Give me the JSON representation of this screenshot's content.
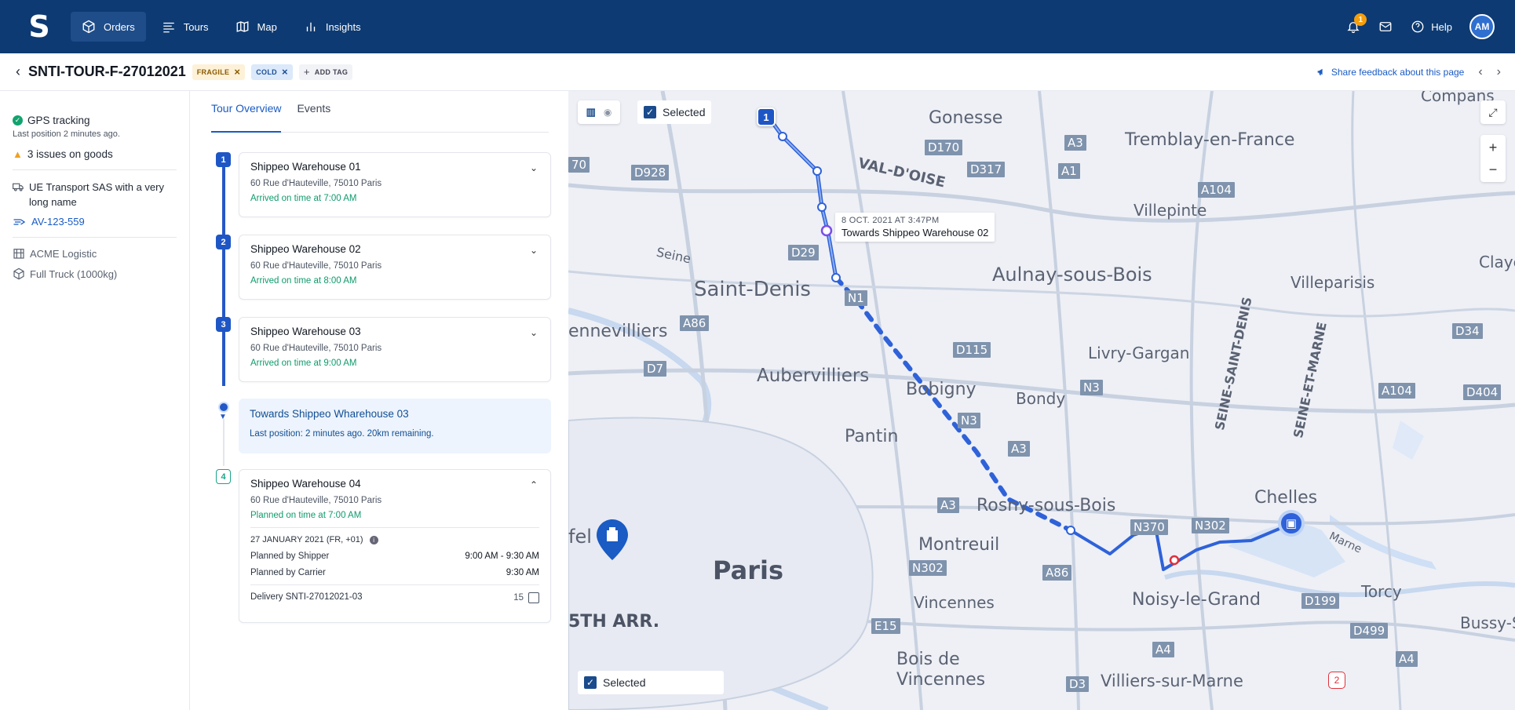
{
  "nav": {
    "logo": "S",
    "items": [
      {
        "label": "Orders",
        "icon": "box-icon",
        "active": true
      },
      {
        "label": "Tours",
        "icon": "list-icon",
        "active": false
      },
      {
        "label": "Map",
        "icon": "map-icon",
        "active": false
      },
      {
        "label": "Insights",
        "icon": "chart-icon",
        "active": false
      }
    ],
    "notifications_count": "1",
    "help_label": "Help",
    "avatar_initials": "AM"
  },
  "header": {
    "title": "SNTI-TOUR-F-27012021",
    "tags": [
      {
        "label": "FRAGILE"
      },
      {
        "label": "COLD"
      }
    ],
    "add_tag_label": "ADD TAG",
    "feedback_label": "Share feedback about this page"
  },
  "left": {
    "gps_label": "GPS tracking",
    "gps_sub": "Last position 2 minutes ago.",
    "issues_label": "3 issues on goods",
    "carrier": "UE Transport SAS with a very long name",
    "vehicle": "AV-123-559",
    "shipper": "ACME Logistic",
    "capacity": "Full Truck (1000kg)"
  },
  "tabs": [
    {
      "label": "Tour Overview"
    },
    {
      "label": "Events"
    }
  ],
  "stops": [
    {
      "n": "1",
      "title": "Shippeo Warehouse 01",
      "addr": "60 Rue d'Hauteville, 75010 Paris",
      "status": "Arrived on time at 7:00 AM"
    },
    {
      "n": "2",
      "title": "Shippeo Warehouse 02",
      "addr": "60 Rue d'Hauteville, 75010 Paris",
      "status": "Arrived on time at 8:00 AM"
    },
    {
      "n": "3",
      "title": "Shippeo Warehouse 03",
      "addr": "60 Rue d'Hauteville, 75010 Paris",
      "status": "Arrived on time at 9:00 AM"
    },
    {
      "n": "4",
      "title": "Shippeo Warehouse 04",
      "addr": "60 Rue d'Hauteville, 75010 Paris",
      "status": "Planned on time at 7:00 AM"
    }
  ],
  "transit": {
    "title": "Towards Shippeo Wharehouse 03",
    "sub": "Last position: 2 minutes ago. 20km remaining."
  },
  "stop4_details": {
    "date": "27 JANUARY 2021 (FR, +01)",
    "shipper_label": "Planned by Shipper",
    "shipper_value": "9:00 AM - 9:30 AM",
    "carrier_label": "Planned by Carrier",
    "carrier_value": "9:30 AM",
    "delivery_label": "Delivery SNTI-27012021-03",
    "delivery_count": "15"
  },
  "map": {
    "selected_label": "Selected",
    "tooltip_time": "8 OCT. 2021 AT 3:47PM",
    "tooltip_text": "Towards Shippeo Warehouse 02",
    "marker_1": "1",
    "marker_2": "2",
    "places": [
      {
        "name": "Gonesse"
      },
      {
        "name": "Tremblay-en-France"
      },
      {
        "name": "VAL-D'OISE"
      },
      {
        "name": "Villepinte"
      },
      {
        "name": "Saint-Denis"
      },
      {
        "name": "Aulnay-sous-Bois"
      },
      {
        "name": "Villeparisis"
      },
      {
        "name": "Aubervilliers"
      },
      {
        "name": "Livry-Gargan"
      },
      {
        "name": "Bobigny"
      },
      {
        "name": "Bondy"
      },
      {
        "name": "Pantin"
      },
      {
        "name": "Rosny-sous-Bois"
      },
      {
        "name": "Chelles"
      },
      {
        "name": "Montreuil"
      },
      {
        "name": "Paris"
      },
      {
        "name": "Noisy-le-Grand"
      },
      {
        "name": "Vincennes"
      },
      {
        "name": "Bois de Vincennes"
      },
      {
        "name": "Villiers-sur-Marne"
      },
      {
        "name": "Torcy"
      },
      {
        "name": "Bussy-S"
      },
      {
        "name": "5TH ARR."
      },
      {
        "name": "ennevilliers"
      },
      {
        "name": "Compans"
      },
      {
        "name": "Claye-"
      },
      {
        "name": "SEINE-SAINT-DENIS"
      },
      {
        "name": "SEINE-ET-MARNE"
      },
      {
        "name": "Seine"
      },
      {
        "name": "Marne"
      },
      {
        "name": "fel"
      },
      {
        "name": "Champigny-sur-Marne"
      }
    ],
    "roads": [
      "D170",
      "A3",
      "D317",
      "A1",
      "A104",
      "D928",
      "D29",
      "N1",
      "A86",
      "D115",
      "N3",
      "D34",
      "A104",
      "D404",
      "D7",
      "N3",
      "A3",
      "A3",
      "N370",
      "N302",
      "N302",
      "A86",
      "D199",
      "D499",
      "A4",
      "A4",
      "E15",
      "D3",
      "70"
    ]
  },
  "colors": {
    "primary": "#0d3a72",
    "accent": "#1a5bc4",
    "success": "#0f9b6e",
    "route": "#2f62d9"
  }
}
